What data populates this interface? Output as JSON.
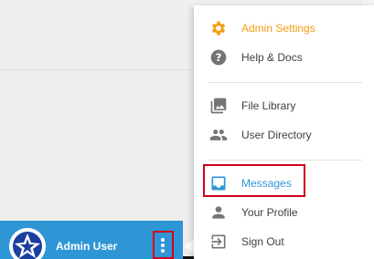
{
  "colors": {
    "accent_orange": "#f39c12",
    "accent_blue": "#2f96d6",
    "highlight_red": "#d0021b",
    "icon_gray": "#757575"
  },
  "user": {
    "name": "Admin User"
  },
  "menu": {
    "items": [
      {
        "label": "Admin Settings",
        "icon": "gear-icon"
      },
      {
        "label": "Help & Docs",
        "icon": "help-icon"
      },
      {
        "label": "File Library",
        "icon": "image-library-icon"
      },
      {
        "label": "User Directory",
        "icon": "people-icon"
      },
      {
        "label": "Messages",
        "icon": "inbox-icon"
      },
      {
        "label": "Your Profile",
        "icon": "person-icon"
      },
      {
        "label": "Sign Out",
        "icon": "sign-out-icon"
      }
    ]
  }
}
